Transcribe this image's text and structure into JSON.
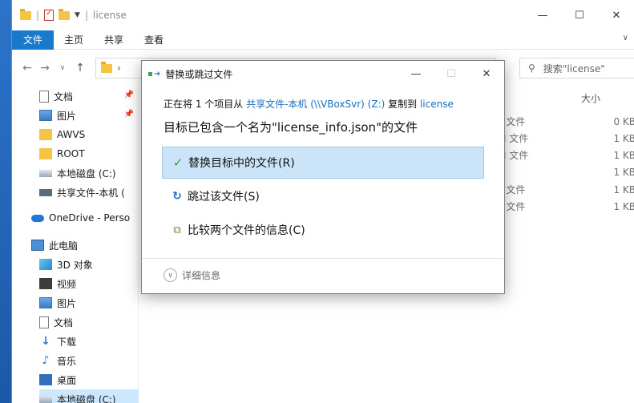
{
  "explorer": {
    "title": "license",
    "controls": {
      "minimize": "—",
      "maximize": "☐",
      "close": "✕"
    },
    "ribbon": {
      "tabs": [
        "文件",
        "主页",
        "共享",
        "查看"
      ],
      "expand_chevron": "∨"
    },
    "address": {
      "back": "←",
      "forward": "→",
      "recent": "∨",
      "up": "↑",
      "crumb_sep": "›",
      "refresh": "↻",
      "search_placeholder": "搜索\"license\""
    },
    "nav_pane": {
      "items": [
        {
          "label": "文档",
          "icon": "documents-icon",
          "pinned": true
        },
        {
          "label": "图片",
          "icon": "pictures-icon",
          "pinned": true
        },
        {
          "label": "AWVS",
          "icon": "folder-icon",
          "pinned": false
        },
        {
          "label": "ROOT",
          "icon": "folder-icon",
          "pinned": false
        },
        {
          "label": "本地磁盘 (C:)",
          "icon": "drive-icon",
          "pinned": false
        },
        {
          "label": "共享文件-本机 (",
          "icon": "network-drive-icon",
          "pinned": false
        },
        {
          "label": "OneDrive - Perso",
          "icon": "onedrive-icon",
          "pinned": false
        },
        {
          "label": "此电脑",
          "icon": "this-pc-icon",
          "pinned": false
        },
        {
          "label": "3D 对象",
          "icon": "3d-objects-icon",
          "pinned": false
        },
        {
          "label": "视频",
          "icon": "videos-icon",
          "pinned": false
        },
        {
          "label": "图片",
          "icon": "pictures-icon",
          "pinned": false
        },
        {
          "label": "文档",
          "icon": "documents-icon",
          "pinned": false
        },
        {
          "label": "下载",
          "icon": "downloads-icon",
          "pinned": false
        },
        {
          "label": "音乐",
          "icon": "music-icon",
          "pinned": false
        },
        {
          "label": "桌面",
          "icon": "desktop-icon",
          "pinned": false
        },
        {
          "label": "本地磁盘 (C:)",
          "icon": "drive-icon",
          "pinned": false
        }
      ],
      "pin_glyph": "📌"
    },
    "file_list": {
      "columns": {
        "type": "型",
        "size": "大小"
      },
      "rows": [
        {
          "type": "AT 文件",
          "size": "0 KB"
        },
        {
          "type": "ON 文件",
          "size": "1 KB"
        },
        {
          "type": "ON 文件",
          "size": "1 KB"
        },
        {
          "type": "件",
          "size": "1 KB"
        },
        {
          "type": "AT 文件",
          "size": "1 KB"
        },
        {
          "type": "AT 文件",
          "size": "1 KB"
        }
      ]
    }
  },
  "dialog": {
    "title": "替换或跳过文件",
    "controls": {
      "minimize": "—",
      "maximize": "☐",
      "close": "✕"
    },
    "progress_line": {
      "prefix": "正在将 1 个项目从 ",
      "source": "共享文件-本机 (\\\\VBoxSvr) (Z:)",
      "middle": " 复制到 ",
      "destination": "license"
    },
    "heading": "目标已包含一个名为\"license_info.json\"的文件",
    "options": [
      {
        "label": "替换目标中的文件(R)",
        "icon": "checkmark-icon",
        "glyph": "✓",
        "selected": true
      },
      {
        "label": "跳过该文件(S)",
        "icon": "skip-icon",
        "glyph": "↻",
        "selected": false
      },
      {
        "label": "比较两个文件的信息(C)",
        "icon": "compare-icon",
        "glyph": "⧉",
        "selected": false
      }
    ],
    "details": {
      "label": "详细信息",
      "glyph": "∨"
    }
  }
}
